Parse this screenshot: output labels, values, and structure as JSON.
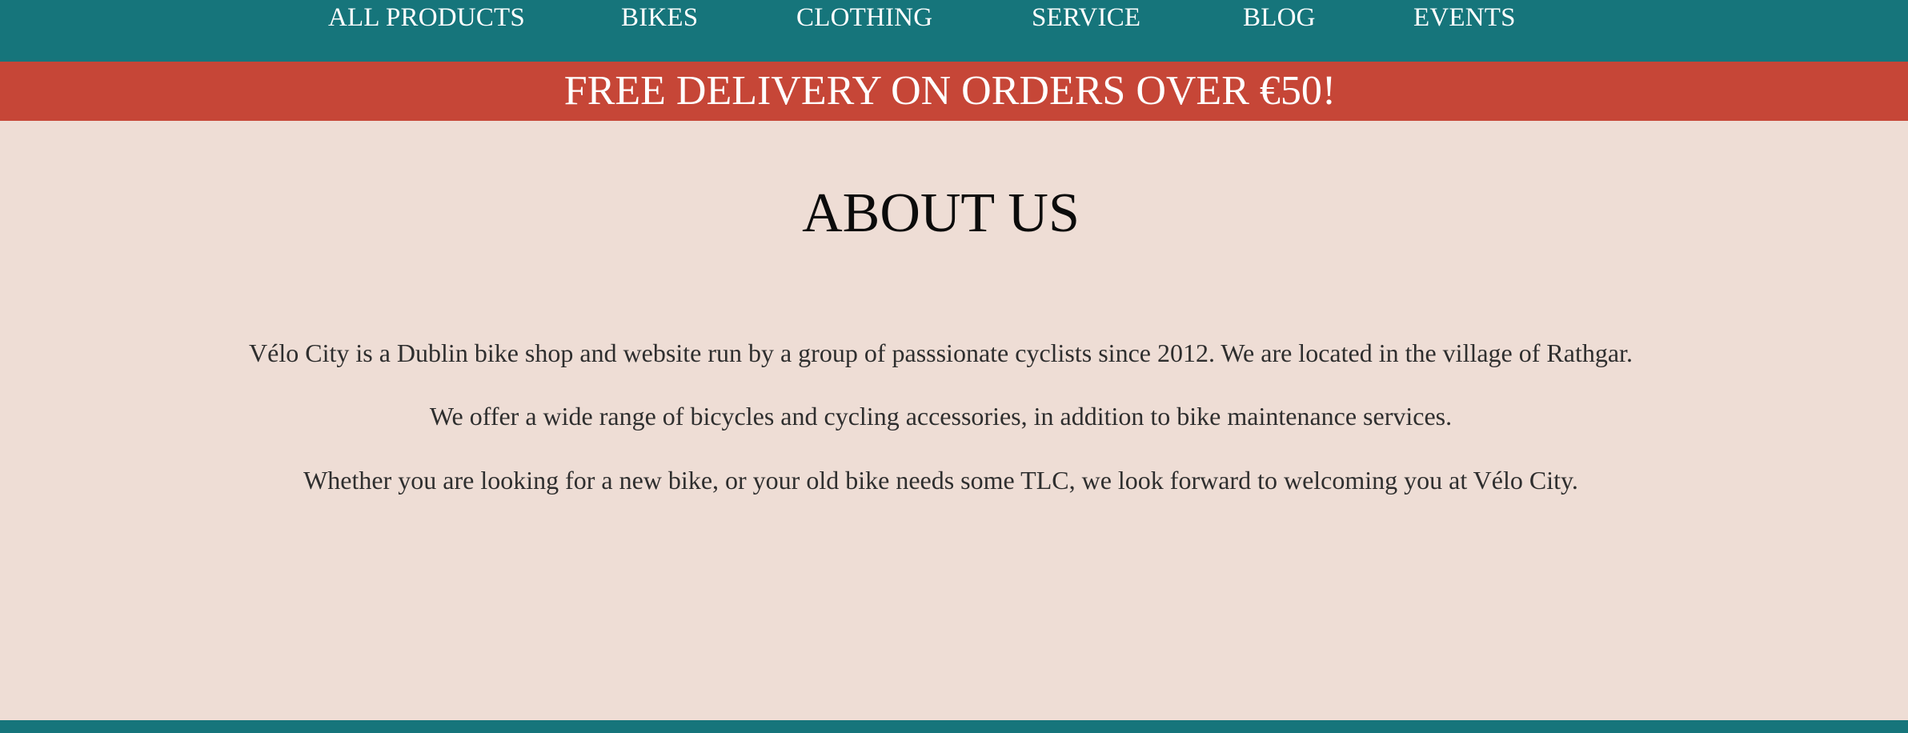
{
  "nav": {
    "items": [
      {
        "label": "ALL PRODUCTS"
      },
      {
        "label": "BIKES"
      },
      {
        "label": "CLOTHING"
      },
      {
        "label": "SERVICE"
      },
      {
        "label": "BLOG"
      },
      {
        "label": "EVENTS"
      }
    ]
  },
  "promo": {
    "text": "FREE DELIVERY ON ORDERS OVER €50!"
  },
  "about": {
    "title": "ABOUT US",
    "paragraphs": [
      "Vélo City is a Dublin bike shop and website run by a group of passsionate cyclists since 2012. We are located in the village of Rathgar.",
      "We offer a wide range of bicycles and cycling accessories, in addition to bike maintenance services.",
      "Whether you are looking for a new bike, or your old bike needs some TLC, we look forward to welcoming you at Vélo City."
    ]
  },
  "colors": {
    "nav_background": "#16757b",
    "promo_background": "#c64637",
    "page_background": "#eeddd5",
    "title_text": "#0b0b0b",
    "body_text": "#2e2e2e",
    "nav_text": "#ffffff"
  }
}
